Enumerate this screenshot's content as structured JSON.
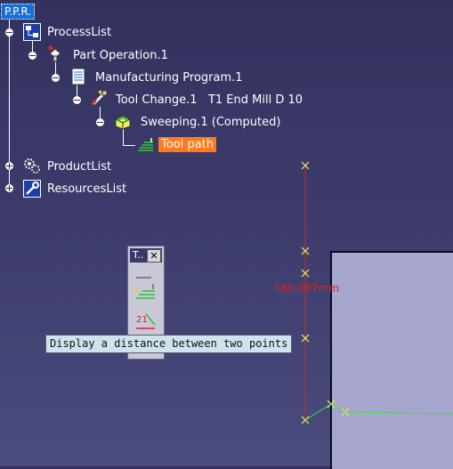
{
  "tree": {
    "root_label": "P.P.R.",
    "process_list": "ProcessList",
    "part_operation": "Part Operation.1",
    "manufacturing_program": "Manufacturing Program.1",
    "tool_change": "Tool Change.1   T1 End Mill D 10",
    "sweeping": "Sweeping.1 (Computed)",
    "tool_path": "Tool path",
    "product_list": "ProductList",
    "resources_list": "ResourcesList"
  },
  "toolbar": {
    "title": "T..",
    "close_glyph": "✕",
    "buttons": [
      {
        "icon": "point-to-point-distance-icon"
      },
      {
        "icon": "display-distance-icon"
      }
    ]
  },
  "tooltip": {
    "text": "Display a distance between two points"
  },
  "measurement": {
    "label": "160.007mm"
  },
  "colors": {
    "background": "#3c3b6b",
    "selection": "#1a6ed8",
    "toolpath_highlight": "#ff7a1a",
    "dimension": "#e02020",
    "toolpath_line": "#40e040",
    "part_face": "#a6a6ce"
  }
}
